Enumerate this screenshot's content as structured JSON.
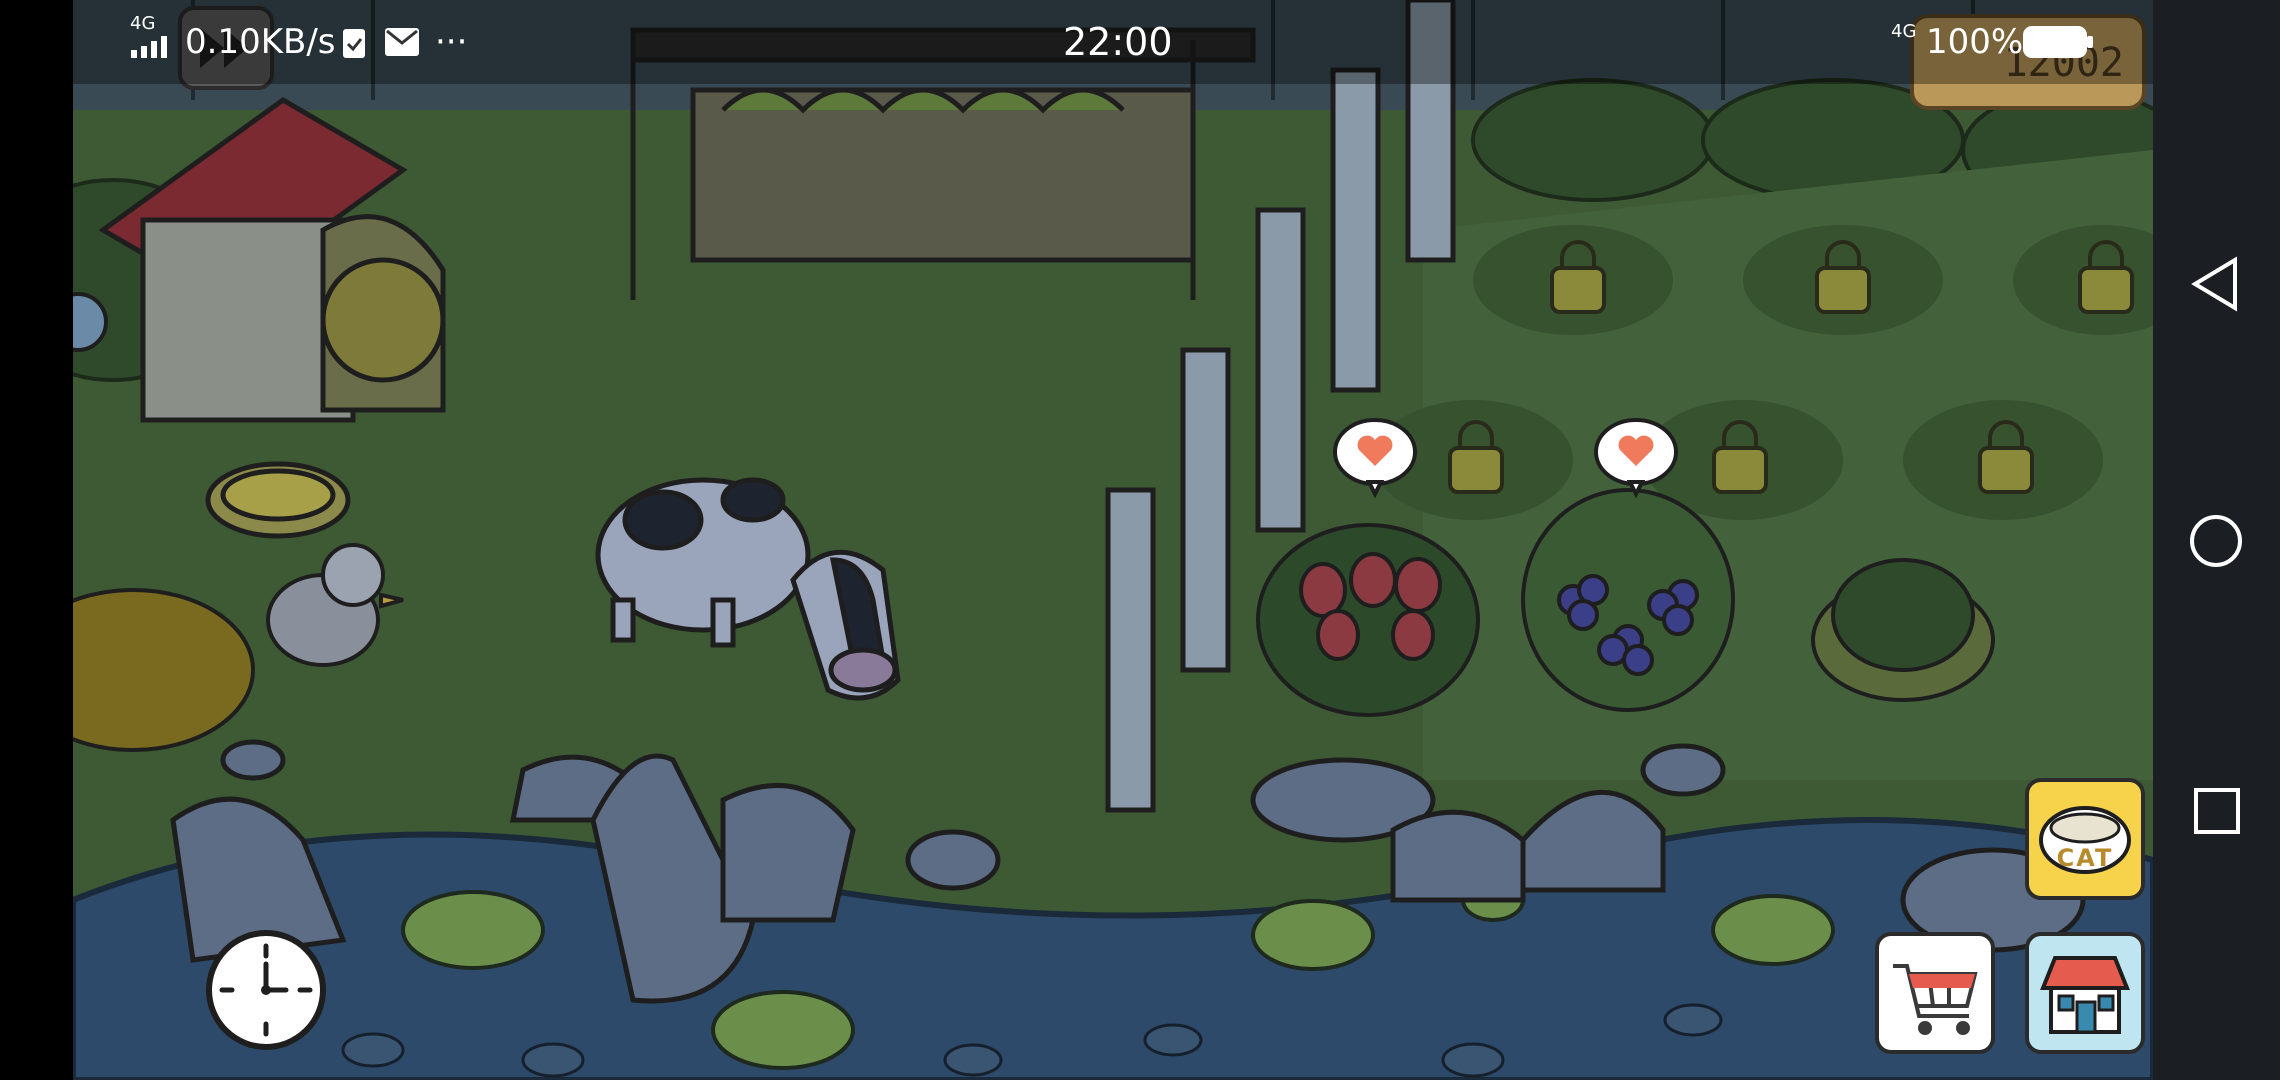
{
  "status_bar": {
    "network": "4G",
    "speed": "0.10KB/s",
    "more": "···",
    "time": "22:00",
    "battery": "100%"
  },
  "hud": {
    "fish_counter": "12002",
    "cat_food_label": "CAT"
  },
  "icons": [
    "fast-forward-icon",
    "clock-icon",
    "shopping-cart-icon",
    "shop-icon",
    "cat-food-bowl-icon",
    "lock-icon",
    "heart-icon",
    "back-icon",
    "home-icon",
    "recents-icon"
  ],
  "colors": {
    "grass": "#3d5a34",
    "water": "#2d4a6a",
    "heart": "#ef7a5c",
    "cat_food": "#f6d34a"
  }
}
